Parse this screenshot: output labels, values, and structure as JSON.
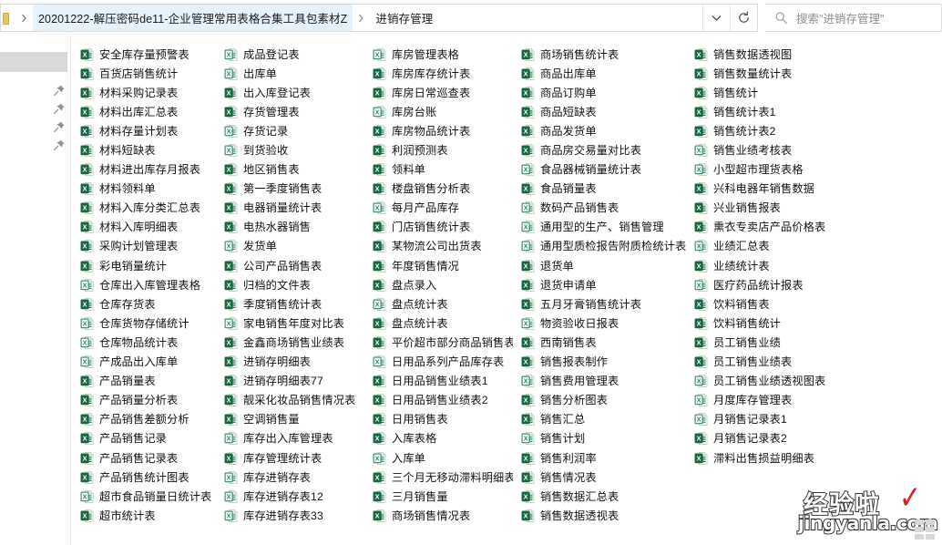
{
  "window": {
    "title": "进销存管理"
  },
  "address_bar": {
    "breadcrumbs": [
      {
        "label": "20201222-解压密码de11-企业管理常用表格合集工具包素材Z",
        "highlighted": true
      },
      {
        "label": "进销存管理",
        "highlighted": false
      }
    ],
    "dropdown_icon": "chevron-down-icon",
    "refresh_icon": "refresh-icon"
  },
  "search": {
    "icon": "search-icon",
    "placeholder": "搜索\"进销存管理\""
  },
  "nav_pane": {
    "pinned_icon": "pin-icon",
    "pin_count": 4,
    "selected_item_label": ""
  },
  "watermark": {
    "cn_text": "经验啦",
    "en_text": "jingyanla.com",
    "check_mark": "✓",
    "check_color": "#e02020"
  },
  "icon_colors": {
    "xlsx_green": "#1d7044",
    "xls_green": "#1f8a5a",
    "page_white": "#ffffff",
    "page_border": "#c7d4c9"
  },
  "file_list": {
    "view": "list",
    "columns": [
      {
        "items": [
          {
            "name": "安全库存量预警表",
            "type": "xlsx"
          },
          {
            "name": "百货店销售统计",
            "type": "xlsx"
          },
          {
            "name": "材料采购记录表",
            "type": "xlsx"
          },
          {
            "name": "材料出库汇总表",
            "type": "xlsx"
          },
          {
            "name": "材料存量计划表",
            "type": "xlsx"
          },
          {
            "name": "材料短缺表",
            "type": "xlsx"
          },
          {
            "name": "材料进出库存月报表",
            "type": "xlsx"
          },
          {
            "name": "材料领料单",
            "type": "xlsx"
          },
          {
            "name": "材料入库分类汇总表",
            "type": "xlsx"
          },
          {
            "name": "材料入库明细表",
            "type": "xlsx"
          },
          {
            "name": "采购计划管理表",
            "type": "xlsx"
          },
          {
            "name": "彩电销量统计",
            "type": "xlsx"
          },
          {
            "name": "仓库出入库管理表格",
            "type": "xls"
          },
          {
            "name": "仓库存货表",
            "type": "xlsx"
          },
          {
            "name": "仓库货物存储统计",
            "type": "xls"
          },
          {
            "name": "仓库物品统计表",
            "type": "xls"
          },
          {
            "name": "产成品出入库单",
            "type": "xls"
          },
          {
            "name": "产品销量表",
            "type": "xlsx"
          },
          {
            "name": "产品销量分析表",
            "type": "xlsx"
          },
          {
            "name": "产品销售差额分析",
            "type": "xlsx"
          },
          {
            "name": "产品销售记录",
            "type": "xlsx"
          },
          {
            "name": "产品销售记录表",
            "type": "xlsx"
          },
          {
            "name": "产品销售统计图表",
            "type": "xlsx"
          },
          {
            "name": "超市食品销量日统计表",
            "type": "xls"
          },
          {
            "name": "超市统计表",
            "type": "xlsx"
          }
        ]
      },
      {
        "items": [
          {
            "name": "成品登记表",
            "type": "xls"
          },
          {
            "name": "出库单",
            "type": "xls"
          },
          {
            "name": "出入库登记表",
            "type": "xlsx"
          },
          {
            "name": "存货管理表",
            "type": "xlsx"
          },
          {
            "name": "存货记录",
            "type": "xls"
          },
          {
            "name": "到货验收",
            "type": "xls"
          },
          {
            "name": "地区销售表",
            "type": "xlsx"
          },
          {
            "name": "第一季度销售表",
            "type": "xlsx"
          },
          {
            "name": "电器销量统计表",
            "type": "xlsx"
          },
          {
            "name": "电热水器销售",
            "type": "xlsx"
          },
          {
            "name": "发货单",
            "type": "xls"
          },
          {
            "name": "公司产品销售表",
            "type": "xlsx"
          },
          {
            "name": "归档的文件表",
            "type": "xlsx"
          },
          {
            "name": "季度销售统计表",
            "type": "xlsx"
          },
          {
            "name": "家电销售年度对比表",
            "type": "xls"
          },
          {
            "name": "金鑫商场销售业绩表",
            "type": "xlsx"
          },
          {
            "name": "进销存明细表",
            "type": "xlsx"
          },
          {
            "name": "进销存明细表77",
            "type": "xlsx"
          },
          {
            "name": "靓采化妆品销售情况表",
            "type": "xlsx"
          },
          {
            "name": "空调销售量",
            "type": "xlsx"
          },
          {
            "name": "库存出入库管理表",
            "type": "xls"
          },
          {
            "name": "库存管理统计表",
            "type": "xlsx"
          },
          {
            "name": "库存进销存表",
            "type": "xls"
          },
          {
            "name": "库存进销存表12",
            "type": "xls"
          },
          {
            "name": "库存进销存表33",
            "type": "xls"
          }
        ]
      },
      {
        "items": [
          {
            "name": "库房管理表格",
            "type": "xls"
          },
          {
            "name": "库房库存统计表",
            "type": "xlsx"
          },
          {
            "name": "库房日常巡查表",
            "type": "xlsx"
          },
          {
            "name": "库房台账",
            "type": "xls"
          },
          {
            "name": "库房物品统计表",
            "type": "xlsx"
          },
          {
            "name": "利润预测表",
            "type": "xlsx"
          },
          {
            "name": "领料单",
            "type": "xlsx"
          },
          {
            "name": "楼盘销售分析表",
            "type": "xlsx"
          },
          {
            "name": "每月产品库存",
            "type": "xls"
          },
          {
            "name": "门店销售统计表",
            "type": "xlsx"
          },
          {
            "name": "某物流公司出货表",
            "type": "xlsx"
          },
          {
            "name": "年度销售情况",
            "type": "xlsx"
          },
          {
            "name": "盘点录入",
            "type": "xlsx"
          },
          {
            "name": "盘点统计表",
            "type": "xls"
          },
          {
            "name": "盘点统计表",
            "type": "xlsx"
          },
          {
            "name": "平价超市部分商品销售表",
            "type": "xlsx"
          },
          {
            "name": "日用品系列产品库存表",
            "type": "xls"
          },
          {
            "name": "日用品销售业绩表1",
            "type": "xlsx"
          },
          {
            "name": "日用品销售业绩表2",
            "type": "xlsx"
          },
          {
            "name": "日用销售表",
            "type": "xlsx"
          },
          {
            "name": "入库表格",
            "type": "xlsx"
          },
          {
            "name": "入库单",
            "type": "xls"
          },
          {
            "name": "三个月无移动滞料明细表",
            "type": "xlsx"
          },
          {
            "name": "三月销售量",
            "type": "xlsx"
          },
          {
            "name": "商场销售情况表",
            "type": "xlsx"
          }
        ]
      },
      {
        "items": [
          {
            "name": "商场销售统计表",
            "type": "xlsx"
          },
          {
            "name": "商品出库单",
            "type": "xlsx"
          },
          {
            "name": "商品订购单",
            "type": "xlsx"
          },
          {
            "name": "商品短缺表",
            "type": "xlsx"
          },
          {
            "name": "商品发货单",
            "type": "xlsx"
          },
          {
            "name": "商品房交易量对比表",
            "type": "xlsx"
          },
          {
            "name": "食品器械销量统计表",
            "type": "xls"
          },
          {
            "name": "食品销量表",
            "type": "xlsx"
          },
          {
            "name": "数码产品销售表",
            "type": "xls"
          },
          {
            "name": "通用型的生产、销售管理",
            "type": "xls"
          },
          {
            "name": "通用型质检报告附质检统计表",
            "type": "xls"
          },
          {
            "name": "退货单",
            "type": "xlsx"
          },
          {
            "name": "退货申请单",
            "type": "xlsx"
          },
          {
            "name": "五月牙膏销售统计表",
            "type": "xlsx"
          },
          {
            "name": "物资验收日报表",
            "type": "xls"
          },
          {
            "name": "西南销售表",
            "type": "xlsx"
          },
          {
            "name": "销售报表制作",
            "type": "xlsx"
          },
          {
            "name": "销售费用管理表",
            "type": "xls"
          },
          {
            "name": "销售分析图表",
            "type": "xlsx"
          },
          {
            "name": "销售汇总",
            "type": "xlsx"
          },
          {
            "name": "销售计划",
            "type": "xls"
          },
          {
            "name": "销售利润率",
            "type": "xlsx"
          },
          {
            "name": "销售情况表",
            "type": "xlsx"
          },
          {
            "name": "销售数据汇总表",
            "type": "xlsx"
          },
          {
            "name": "销售数据透视表",
            "type": "xlsx"
          }
        ]
      },
      {
        "items": [
          {
            "name": "销售数据透视图",
            "type": "xlsx"
          },
          {
            "name": "销售数量统计表",
            "type": "xlsx"
          },
          {
            "name": "销售统计",
            "type": "xlsx"
          },
          {
            "name": "销售统计表1",
            "type": "xlsx"
          },
          {
            "name": "销售统计表2",
            "type": "xlsx"
          },
          {
            "name": "销售业绩考核表",
            "type": "xls"
          },
          {
            "name": "小型超市理货表格",
            "type": "xls"
          },
          {
            "name": "兴科电器年销售数据",
            "type": "xlsx"
          },
          {
            "name": "兴业销售报表",
            "type": "xlsx"
          },
          {
            "name": "熏衣专卖店产品价格表",
            "type": "xlsx"
          },
          {
            "name": "业绩汇总表",
            "type": "xls"
          },
          {
            "name": "业绩统计表",
            "type": "xlsx"
          },
          {
            "name": "医疗药品统计报表",
            "type": "xls"
          },
          {
            "name": "饮料销售表",
            "type": "xlsx"
          },
          {
            "name": "饮料销售统计",
            "type": "xlsx"
          },
          {
            "name": "员工销售业绩",
            "type": "xlsx"
          },
          {
            "name": "员工销售业绩表",
            "type": "xlsx"
          },
          {
            "name": "员工销售业绩透视图表",
            "type": "xls"
          },
          {
            "name": "月度库存管理表",
            "type": "xls"
          },
          {
            "name": "月销售记录表1",
            "type": "xls"
          },
          {
            "name": "月销售记录表2",
            "type": "xlsx"
          },
          {
            "name": "滞料出售损益明细表",
            "type": "xlsx"
          }
        ]
      }
    ]
  }
}
